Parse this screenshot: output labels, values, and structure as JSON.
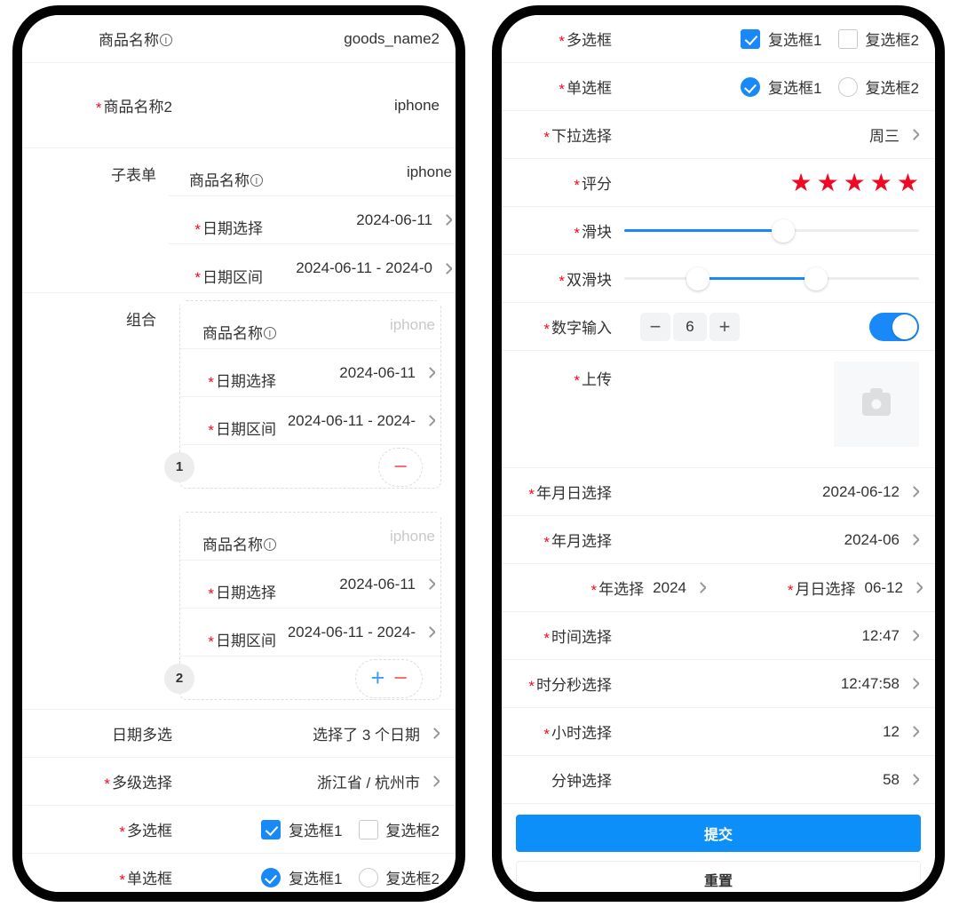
{
  "theme": {
    "accent_blue": "#1989fa",
    "required_red": "#ee0a24",
    "star_red": "#ee0a24",
    "submit_blue": "#0d8ffa",
    "border_gray": "#f1f1f3",
    "placeholder_gray": "#c8c9cc"
  },
  "left_phone": {
    "rows": {
      "goods_name_label": "商品名称",
      "goods_name_value": "goods_name2",
      "goods_name2_label": "商品名称2",
      "goods_name2_value": "iphone",
      "subform_label": "子表单",
      "group_label": "组合",
      "date_multi_label": "日期多选",
      "date_multi_value": "选择了 3 个日期",
      "cascader_label": "多级选择",
      "cascader_value": "浙江省 / 杭州市",
      "checkbox_label": "多选框",
      "radio_label": "单选框"
    },
    "subform": {
      "name_label": "商品名称",
      "name_value": "iphone",
      "date_label": "日期选择",
      "date_value": "2024-06-11",
      "range_label": "日期区间",
      "range_value": "2024-06-11 - 2024-0"
    },
    "groups": [
      {
        "index": "1",
        "name_label": "商品名称",
        "name_placeholder": "iphone",
        "date_label": "日期选择",
        "date_value": "2024-06-11",
        "range_label": "日期区间",
        "range_value": "2024-06-11 - 2024-",
        "actions": [
          "minus"
        ]
      },
      {
        "index": "2",
        "name_label": "商品名称",
        "name_placeholder": "iphone",
        "date_label": "日期选择",
        "date_value": "2024-06-11",
        "range_label": "日期区间",
        "range_value": "2024-06-11 - 2024-",
        "actions": [
          "plus",
          "minus"
        ]
      }
    ],
    "checkbox_options": [
      {
        "label": "复选框1",
        "checked": true
      },
      {
        "label": "复选框2",
        "checked": false
      }
    ],
    "radio_options": [
      {
        "label": "复选框1",
        "checked": true
      },
      {
        "label": "复选框2",
        "checked": false
      }
    ]
  },
  "right_phone": {
    "checkbox_label": "多选框",
    "checkbox_options": [
      {
        "label": "复选框1",
        "checked": true
      },
      {
        "label": "复选框2",
        "checked": false
      }
    ],
    "radio_label": "单选框",
    "radio_options": [
      {
        "label": "复选框1",
        "checked": true
      },
      {
        "label": "复选框2",
        "checked": false
      }
    ],
    "select_label": "下拉选择",
    "select_value": "周三",
    "rate_label": "评分",
    "rate_value": 5,
    "rate_max": 5,
    "slider_label": "滑块",
    "slider_value": 54,
    "dual_slider_label": "双滑块",
    "dual_slider_values": [
      25,
      65
    ],
    "stepper_label": "数字输入",
    "stepper_value": "6",
    "stepper_minus": "−",
    "stepper_plus": "+",
    "switch_on": true,
    "upload_label": "上传",
    "pickers": [
      {
        "label": "年月日选择",
        "value": "2024-06-12",
        "required": true
      },
      {
        "label": "年月选择",
        "value": "2024-06",
        "required": true
      }
    ],
    "half_pickers": [
      {
        "label": "年选择",
        "value": "2024",
        "required": true
      },
      {
        "label": "月日选择",
        "value": "06-12",
        "required": true
      }
    ],
    "time_pickers": [
      {
        "label": "时间选择",
        "value": "12:47",
        "required": true
      },
      {
        "label": "时分秒选择",
        "value": "12:47:58",
        "required": true
      },
      {
        "label": "小时选择",
        "value": "12",
        "required": true
      },
      {
        "label": "分钟选择",
        "value": "58",
        "required": false
      }
    ],
    "submit_label": "提交",
    "reset_label": "重置"
  }
}
